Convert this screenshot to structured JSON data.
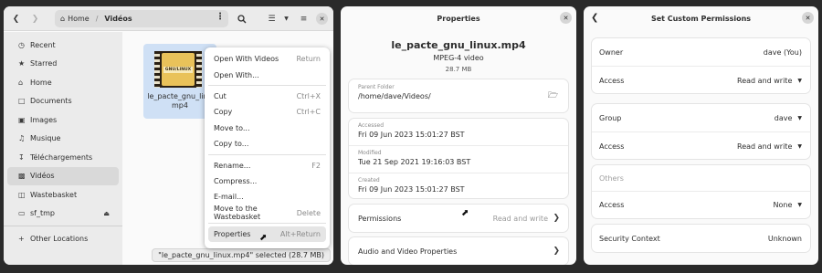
{
  "files_window": {
    "back_icon": "chevron-left-icon",
    "forward_icon": "chevron-right-icon",
    "path": {
      "home": "Home",
      "separator": "/",
      "current": "Vidéos"
    },
    "sidebar": [
      {
        "label": "Recent",
        "icon": "clock-icon"
      },
      {
        "label": "Starred",
        "icon": "star-icon"
      },
      {
        "label": "Home",
        "icon": "home-icon"
      },
      {
        "label": "Documents",
        "icon": "document-icon"
      },
      {
        "label": "Images",
        "icon": "image-icon"
      },
      {
        "label": "Musique",
        "icon": "music-icon"
      },
      {
        "label": "Téléchargements",
        "icon": "download-icon"
      },
      {
        "label": "Vidéos",
        "icon": "video-icon",
        "active": true
      },
      {
        "label": "Wastebasket",
        "icon": "trash-icon"
      },
      {
        "label": "sf_tmp",
        "icon": "drive-icon"
      },
      {
        "label": "Other Locations",
        "icon": "plus-icon"
      }
    ],
    "file": {
      "name_line1": "le_pacte_gnu_linu",
      "name_line2": "mp4",
      "thumb_text": "GNU/LINUX"
    },
    "status": "\"le_pacte_gnu_linux.mp4\" selected  (28.7 MB)",
    "menu": [
      {
        "label": "Open With Videos",
        "accel": "Return"
      },
      {
        "label": "Open With...",
        "accel": ""
      },
      {
        "label": "Cut",
        "accel": "Ctrl+X"
      },
      {
        "label": "Copy",
        "accel": "Ctrl+C"
      },
      {
        "label": "Move to...",
        "accel": ""
      },
      {
        "label": "Copy to...",
        "accel": ""
      },
      {
        "label": "Rename...",
        "accel": "F2"
      },
      {
        "label": "Compress...",
        "accel": ""
      },
      {
        "label": "E-mail...",
        "accel": ""
      },
      {
        "label": "Move to the Wastebasket",
        "accel": "Delete"
      },
      {
        "label": "Properties",
        "accel": "Alt+Return"
      }
    ]
  },
  "properties_window": {
    "title": "Properties",
    "file_name": "le_pacte_gnu_linux.mp4",
    "file_type": "MPEG-4 video",
    "file_size": "28.7 MB",
    "parent_folder": {
      "label": "Parent Folder",
      "value": "/home/dave/Videos/"
    },
    "accessed": {
      "label": "Accessed",
      "value": "Fri 09 Jun 2023 15:01:27 BST"
    },
    "modified": {
      "label": "Modified",
      "value": "Tue 21 Sep 2021 19:16:03 BST"
    },
    "created": {
      "label": "Created",
      "value": "Fri 09 Jun 2023 15:01:27 BST"
    },
    "permissions": {
      "label": "Permissions",
      "value": "Read and write"
    },
    "av_properties": {
      "label": "Audio and Video Properties"
    }
  },
  "permissions_window": {
    "title": "Set Custom Permissions",
    "owner": {
      "label": "Owner",
      "value": "dave (You)"
    },
    "owner_access": {
      "label": "Access",
      "value": "Read and write"
    },
    "group": {
      "label": "Group",
      "value": "dave"
    },
    "group_access": {
      "label": "Access",
      "value": "Read and write"
    },
    "others": {
      "label": "Others"
    },
    "others_access": {
      "label": "Access",
      "value": "None"
    },
    "security_context": {
      "label": "Security Context",
      "value": "Unknown"
    }
  }
}
